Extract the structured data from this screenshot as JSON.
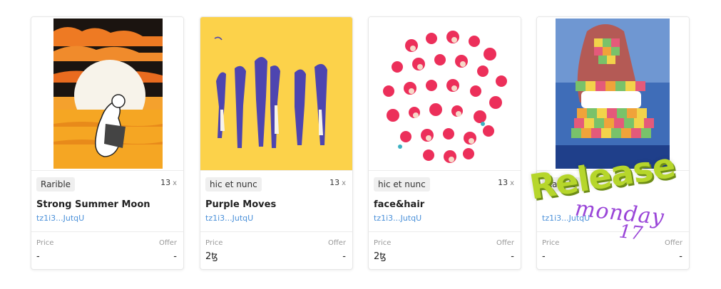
{
  "colors": {
    "accent_link": "#4a90d9",
    "badge_bg": "#efefef",
    "release_green": "#b6d62b",
    "release_purple": "#9a46d8"
  },
  "cards": [
    {
      "artwork": "sun-figure-artwork",
      "platform": "Rarible",
      "edition_count": "13",
      "edition_suffix": "x",
      "title": "Strong Summer Moon",
      "creator": "tz1i3...JutqU",
      "price_label": "Price",
      "price_value": "-",
      "offer_label": "Offer",
      "offer_value": "-"
    },
    {
      "artwork": "purple-figures-artwork",
      "platform": "hic et nunc",
      "edition_count": "13",
      "edition_suffix": "x",
      "title": "Purple Moves",
      "creator": "tz1i3...JutqU",
      "price_label": "Price",
      "price_value": "2ꜩ",
      "offer_label": "Offer",
      "offer_value": "-"
    },
    {
      "artwork": "faces-circle-artwork",
      "platform": "hic et nunc",
      "edition_count": "13",
      "edition_suffix": "x",
      "title": "face&hair",
      "creator": "tz1i3...JutqU",
      "price_label": "Price",
      "price_value": "2ꜩ",
      "offer_label": "Offer",
      "offer_value": "-"
    },
    {
      "artwork": "patchwork-woman-artwork",
      "platform": "Rarible",
      "edition_count": "",
      "edition_suffix": "",
      "title": "",
      "creator": "tz1i3...JutqU",
      "price_label": "Price",
      "price_value": "-",
      "offer_label": "Offer",
      "offer_value": "-"
    }
  ],
  "release_overlay": {
    "line1": "Release",
    "line2": "monday",
    "line3": "17"
  }
}
